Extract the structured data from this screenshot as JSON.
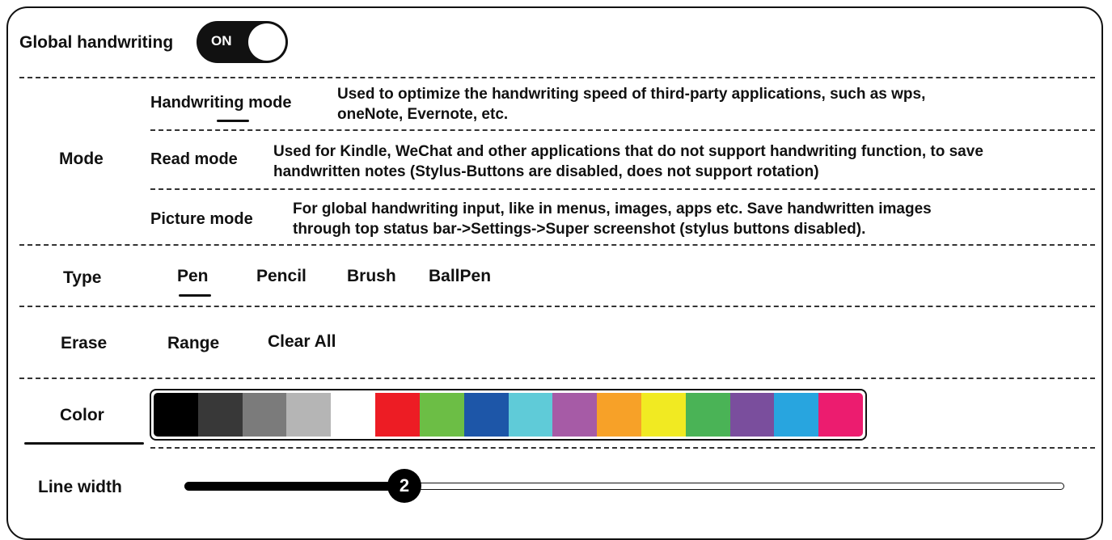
{
  "global": {
    "label": "Global handwriting",
    "toggle_text": "ON",
    "enabled": true
  },
  "mode": {
    "label": "Mode",
    "selected": "Handwriting mode",
    "options": [
      {
        "name": "Handwriting mode",
        "desc1": "Used to optimize the handwriting speed of third-party applications, such as wps,",
        "desc2": "oneNote, Evernote, etc."
      },
      {
        "name": "Read mode",
        "desc1": "Used for Kindle, WeChat and other applications that do not support handwriting function, to save",
        "desc2": "handwritten notes (Stylus-Buttons are disabled, does not support rotation)"
      },
      {
        "name": "Picture mode",
        "desc1": "For global handwriting input, like in menus, images, apps etc. Save handwritten images",
        "desc2": "through top status bar->Settings->Super screenshot (stylus buttons disabled)."
      }
    ]
  },
  "type": {
    "label": "Type",
    "options": [
      "Pen",
      "Pencil",
      "Brush",
      "BallPen"
    ],
    "selected": "Pen"
  },
  "erase": {
    "label": "Erase",
    "options": [
      "Range",
      "Clear All"
    ]
  },
  "color": {
    "label": "Color",
    "swatches": [
      "#000000",
      "#383838",
      "#7b7b7b",
      "#b5b5b5",
      "#ffffff",
      "#ed1c24",
      "#6cbe45",
      "#1d56a8",
      "#5fcbd8",
      "#a65ba6",
      "#f7a128",
      "#f1ea22",
      "#4ab356",
      "#7a4e9d",
      "#28a5df",
      "#ec1c6f"
    ]
  },
  "line_width": {
    "label": "Line width",
    "value": "2"
  }
}
